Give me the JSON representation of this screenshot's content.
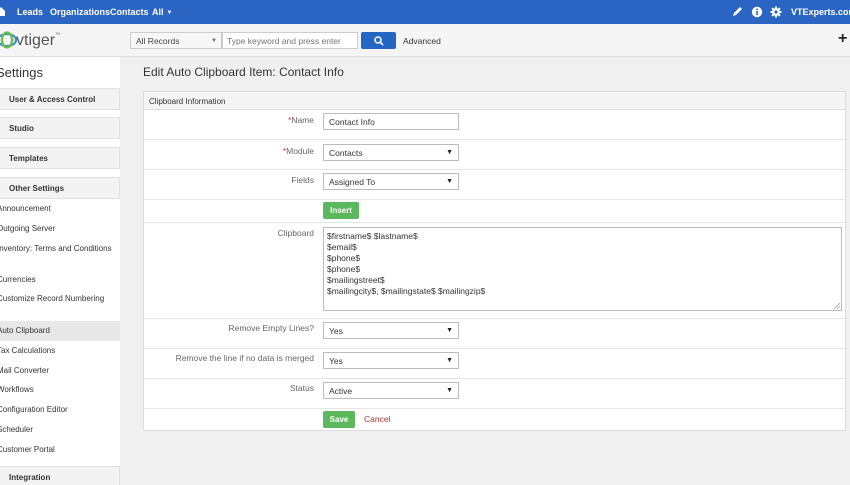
{
  "topnav": {
    "items": [
      {
        "label": "Leads"
      },
      {
        "label": "Organizations"
      },
      {
        "label": "Contacts"
      },
      {
        "label": "All"
      }
    ],
    "site": "VTExperts.com"
  },
  "brand": {
    "name": "vtiger",
    "tm": "™"
  },
  "search": {
    "records_selected": "All Records",
    "placeholder": "Type keyword and press enter",
    "advanced_label": "Advanced"
  },
  "sidebar": {
    "title": "Settings",
    "blocks": [
      {
        "label": "User & Access Control"
      },
      {
        "label": "Studio"
      },
      {
        "label": "Templates"
      },
      {
        "label": "Other Settings"
      },
      {
        "label": "Integration"
      }
    ],
    "items": [
      {
        "label": "Announcement"
      },
      {
        "label": "Outgoing Server"
      },
      {
        "label": "Inventory: Terms and Conditions"
      },
      {
        "label": "Currencies"
      },
      {
        "label": "Customize Record Numbering"
      },
      {
        "label": "Auto Clipboard"
      },
      {
        "label": "Tax Calculations"
      },
      {
        "label": "Mail Converter"
      },
      {
        "label": "Workflows"
      },
      {
        "label": "Configuration Editor"
      },
      {
        "label": "Scheduler"
      },
      {
        "label": "Customer Portal"
      }
    ]
  },
  "page": {
    "title": "Edit Auto Clipboard Item: Contact Info",
    "panel_title": "Clipboard Information"
  },
  "form": {
    "name": {
      "label": "Name",
      "required": "*",
      "value": "Contact Info"
    },
    "module": {
      "label": "Module",
      "required": "*",
      "value": "Contacts"
    },
    "fields": {
      "label": "Fields",
      "value": "Assigned To"
    },
    "insert_label": "Insert",
    "clipboard": {
      "label": "Clipboard",
      "value": "$firstname$ $lastname$\n$email$\n$phone$\n$phone$\n$mailingstreet$\n$mailingcity$, $mailingstate$ $mailingzip$"
    },
    "remove_empty": {
      "label": "Remove Empty Lines?",
      "value": "Yes"
    },
    "remove_line": {
      "label": "Remove the line if no data is merged",
      "value": "Yes"
    },
    "status": {
      "label": "Status",
      "value": "Active"
    },
    "save_label": "Save",
    "cancel_label": "Cancel"
  },
  "colors": {
    "topbar": "#2b65c4",
    "save_green": "#5cb85c",
    "cancel_red": "#b33333",
    "required_red": "#cc3333"
  }
}
